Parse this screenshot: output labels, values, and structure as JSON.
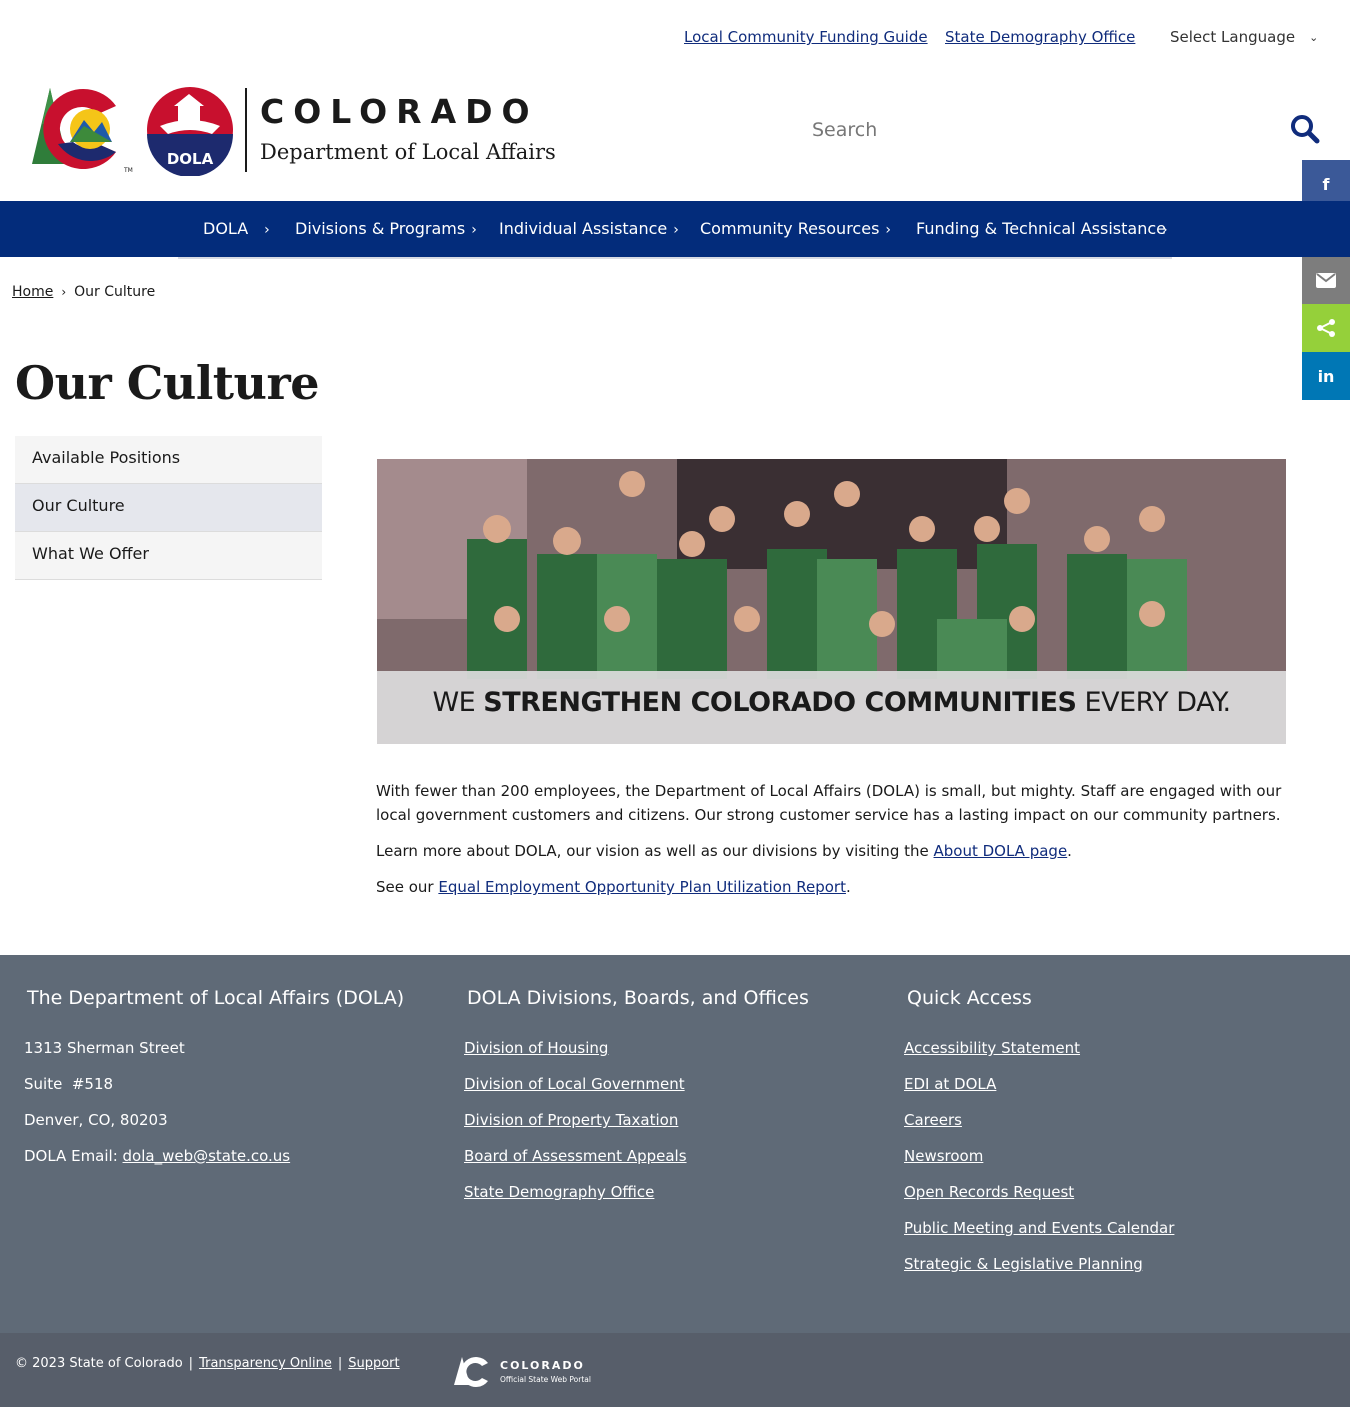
{
  "utility": {
    "links": [
      "Local Community Funding Guide",
      "State Demography Office"
    ],
    "language_label": "Select Language"
  },
  "brand": {
    "state": "COLORADO",
    "department": "Department of Local Affairs",
    "badge_text": "DOLA"
  },
  "search": {
    "placeholder": "Search"
  },
  "nav": {
    "items": [
      "DOLA",
      "Divisions & Programs",
      "Individual Assistance",
      "Community Resources",
      "Funding & Technical Assistance"
    ]
  },
  "share": {
    "icons": [
      "facebook-icon",
      "twitter-icon",
      "email-icon",
      "share-icon",
      "linkedin-icon"
    ],
    "colors": [
      "#3b5998",
      "#55acee",
      "#7d7d7d",
      "#95d03a",
      "#0077b5"
    ]
  },
  "breadcrumb": {
    "home": "Home",
    "current": "Our Culture"
  },
  "page": {
    "title": "Our Culture"
  },
  "side_menu": {
    "items": [
      "Available Positions",
      "Our Culture",
      "What We Offer"
    ],
    "active_index": 1
  },
  "hero": {
    "caption_pre": "WE ",
    "caption_bold": "STRENGTHEN COLORADO COMMUNITIES",
    "caption_post": " EVERY DAY."
  },
  "content": {
    "p1": "With fewer than 200 employees, the Department of Local Affairs (DOLA) is small, but mighty. Staff are engaged with our local government customers and citizens. Our strong customer service has a lasting impact on our community partners.",
    "p2_pre": "Learn more about DOLA, our vision as well as our divisions by visiting the ",
    "p2_link": "About DOLA page",
    "p2_post": ".",
    "p3_pre": "See our ",
    "p3_link": "Equal Employment Opportunity Plan Utilization Report",
    "p3_post": "."
  },
  "footer": {
    "col1": {
      "heading": "The Department of Local Affairs (DOLA)",
      "address1": "1313 Sherman Street",
      "address2": "Suite  #518",
      "address3": "Denver, CO, 80203",
      "email_label": "DOLA Email: ",
      "email": "dola_web@state.co.us"
    },
    "col2": {
      "heading": "DOLA Divisions, Boards, and Offices",
      "links": [
        "Division of Housing",
        "Division of Local Government",
        "Division of Property Taxation",
        "Board of Assessment Appeals",
        "State Demography Office"
      ]
    },
    "col3": {
      "heading": "Quick Access",
      "links": [
        "Accessibility Statement",
        "EDI at DOLA",
        "Careers",
        "Newsroom",
        "Open Records Request",
        "Public Meeting and Events Calendar",
        "Strategic & Legislative Planning"
      ]
    },
    "bottom": {
      "copyright": "© 2023 State of Colorado",
      "sep": "|",
      "links": [
        "Transparency Online",
        "Support"
      ],
      "portal_title": "COLORADO",
      "portal_sub": "Official State Web Portal"
    }
  },
  "colors": {
    "nav": "#032c7b",
    "link": "#102c7c",
    "footer": "#5f6a77",
    "subfooter": "#575e6a",
    "brand_red": "#c8102e"
  }
}
